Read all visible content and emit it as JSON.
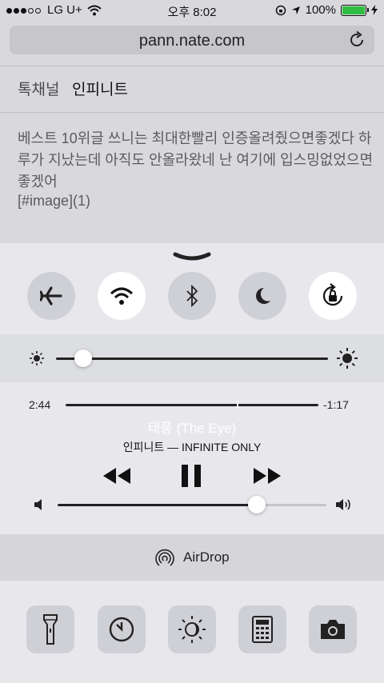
{
  "status_bar": {
    "carrier": "LG U+",
    "time": "오후 8:02",
    "battery": "100%",
    "battery_color": "#2fbe43"
  },
  "browser": {
    "url": "pann.nate.com",
    "breadcrumb_parent": "톡채널",
    "breadcrumb_current": "인피니트",
    "post_text": "베스트 10위글 쓰니는 최대한빨리 인증올려줬으면좋겠다 하루가 지났는데 아직도 안올라왔네 난 여기에 입스밍없었으면좋겠어",
    "post_link": "[#image](1)"
  },
  "control_center": {
    "toggles": [
      {
        "name": "airplane-mode",
        "on": false,
        "icon": "airplane-icon"
      },
      {
        "name": "wifi",
        "on": true,
        "icon": "wifi-icon"
      },
      {
        "name": "bluetooth",
        "on": false,
        "icon": "bluetooth-icon"
      },
      {
        "name": "do-not-disturb",
        "on": false,
        "icon": "moon-icon"
      },
      {
        "name": "rotation-lock",
        "on": true,
        "icon": "rotation-lock-icon"
      }
    ],
    "brightness_level": 0.1,
    "music": {
      "elapsed": "2:44",
      "remaining": "-1:17",
      "progress": 0.68,
      "title": "태풍 (The Eye)",
      "artist_album": "인피니트 — INFINITE ONLY",
      "volume_level": 0.74
    },
    "airdrop_label": "AirDrop",
    "tools": [
      "flashlight-icon",
      "timer-icon",
      "night-shift-icon",
      "calculator-icon",
      "camera-icon"
    ]
  }
}
